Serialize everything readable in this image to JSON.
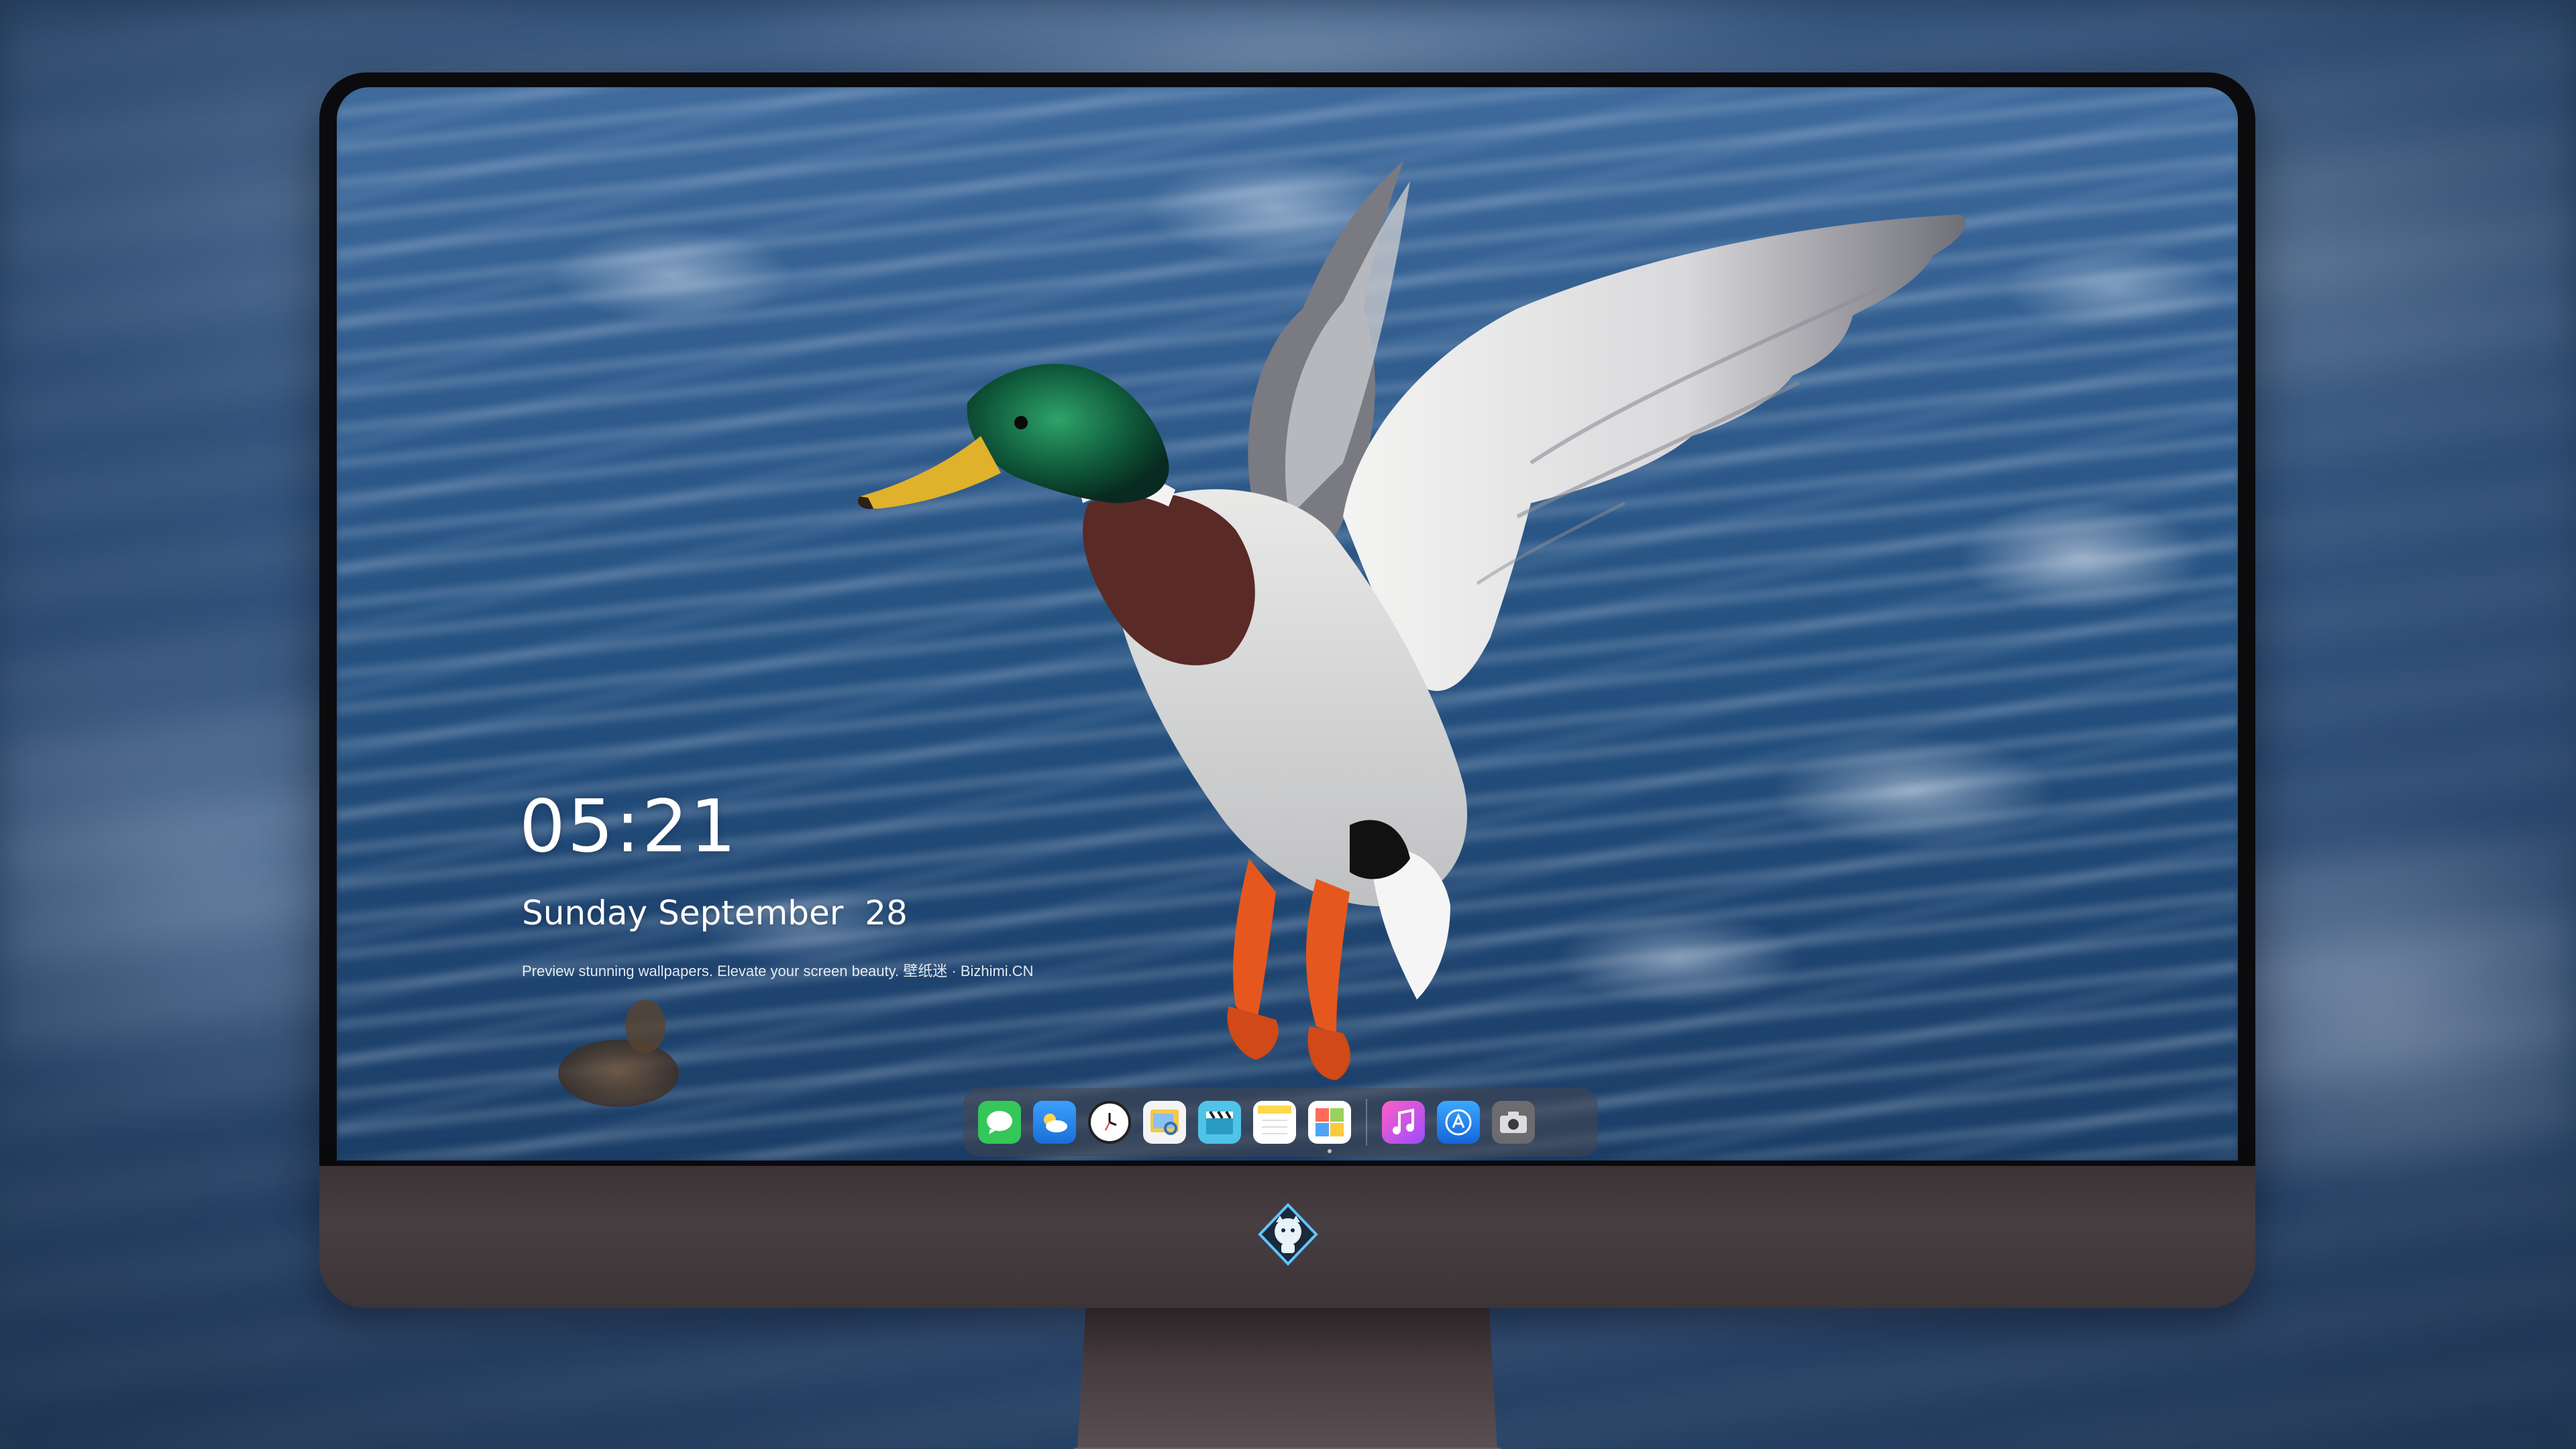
{
  "lockscreen": {
    "time": "05:21",
    "date": "Sunday September  28",
    "tagline": "Preview stunning wallpapers. Elevate your screen beauty. 壁纸迷 · Bizhimi.CN"
  },
  "dock": {
    "apps": [
      {
        "name": "messages",
        "icon": "message-bubble-icon",
        "color": "#34c759"
      },
      {
        "name": "weather",
        "icon": "weather-cloud-icon",
        "color": "#2f8cf0"
      },
      {
        "name": "clock",
        "icon": "clock-icon",
        "color": "#ffffff"
      },
      {
        "name": "preview",
        "icon": "preview-icon",
        "color": "#f2c94c"
      },
      {
        "name": "clips",
        "icon": "clapperboard-icon",
        "color": "#4fc3e8"
      },
      {
        "name": "notes",
        "icon": "notes-icon",
        "color": "#ffd84d"
      },
      {
        "name": "calendar",
        "icon": "calendar-icon",
        "color": "#9ad15a"
      },
      {
        "name": "music",
        "icon": "music-note-icon",
        "color": "#e040fb"
      },
      {
        "name": "app-store",
        "icon": "app-store-icon",
        "color": "#1e90ff"
      },
      {
        "name": "camera",
        "icon": "camera-icon",
        "color": "#6b6b70"
      }
    ]
  },
  "colors": {
    "water": "#2a5585",
    "bezel": "#0b0b0d",
    "chin": "#433a3e"
  }
}
